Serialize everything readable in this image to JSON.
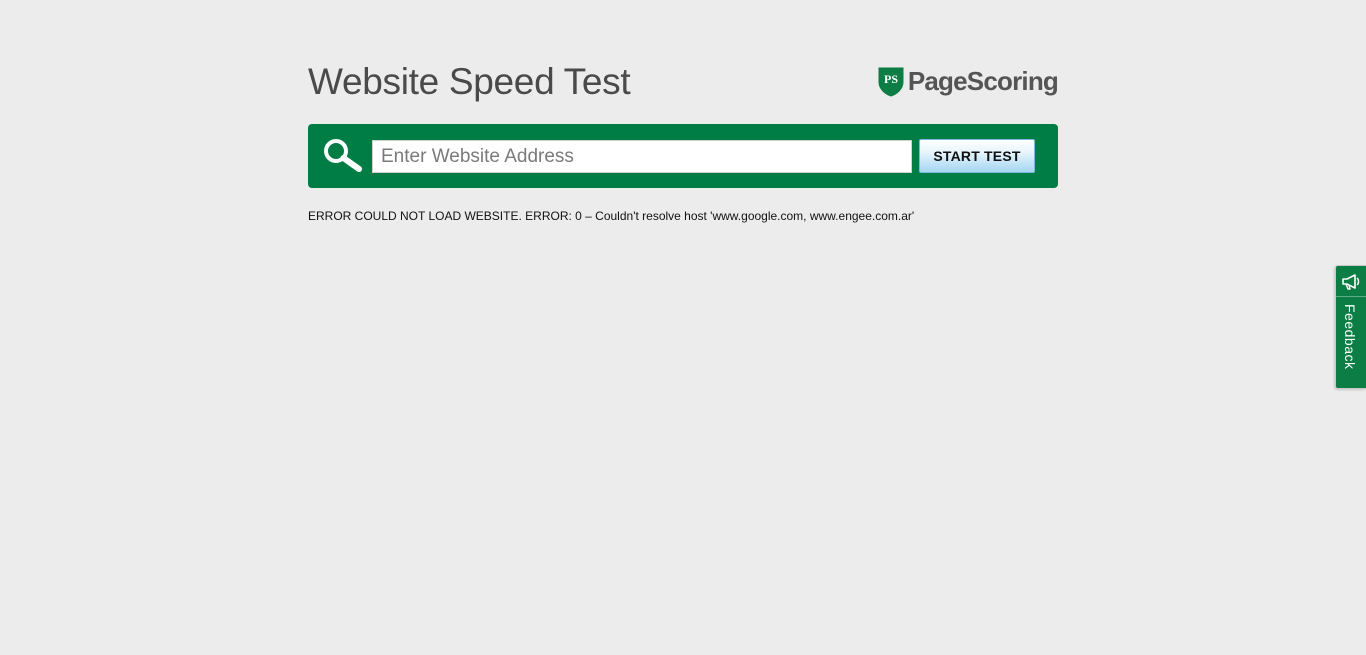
{
  "header": {
    "title": "Website Speed Test",
    "logo_badge_text": "PS",
    "logo_text": "PageScoring"
  },
  "search": {
    "placeholder": "Enter Website Address",
    "value": "",
    "button_label": "START TEST",
    "icon": "search-icon"
  },
  "error": {
    "message": "ERROR COULD NOT LOAD WEBSITE. ERROR: 0 – Couldn't resolve host 'www.google.com, www.engee.com.ar'"
  },
  "feedback": {
    "label": "Feedback",
    "icon": "megaphone-icon"
  },
  "colors": {
    "background": "#ececec",
    "brand_green": "#007d45",
    "title_text": "#4a4a4a",
    "button_gradient_end": "#a7d6f1"
  }
}
